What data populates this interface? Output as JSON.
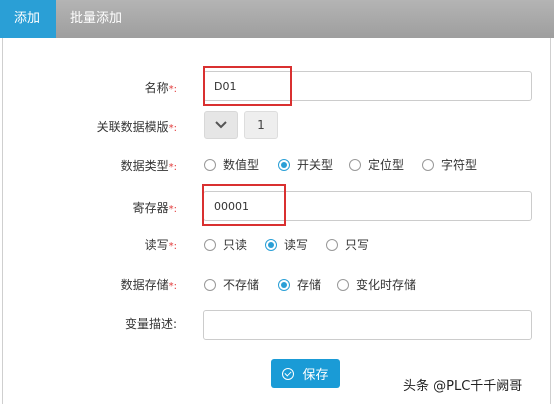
{
  "tabs": [
    {
      "label": "添加",
      "active": true
    },
    {
      "label": "批量添加",
      "active": false
    }
  ],
  "required_mark": "*:",
  "fields": {
    "name": {
      "label": "名称",
      "value": "D01"
    },
    "template": {
      "label": "关联数据模版",
      "value": "1"
    },
    "data_type": {
      "label": "数据类型",
      "options": [
        "数值型",
        "开关型",
        "定位型",
        "字符型"
      ],
      "selected": "开关型"
    },
    "register": {
      "label": "寄存器",
      "value": "00001"
    },
    "rw": {
      "label": "读写",
      "options": [
        "只读",
        "读写",
        "只写"
      ],
      "selected": "读写"
    },
    "storage": {
      "label": "数据存储",
      "options": [
        "不存储",
        "存储",
        "变化时存储"
      ],
      "selected": "存储"
    },
    "description": {
      "label": "变量描述:",
      "value": ""
    }
  },
  "save_label": "保存",
  "watermark": "头条 @PLC千千阙哥",
  "colors": {
    "accent": "#2a9fd6",
    "highlight": "#d93030",
    "required": "#e23b3b"
  }
}
